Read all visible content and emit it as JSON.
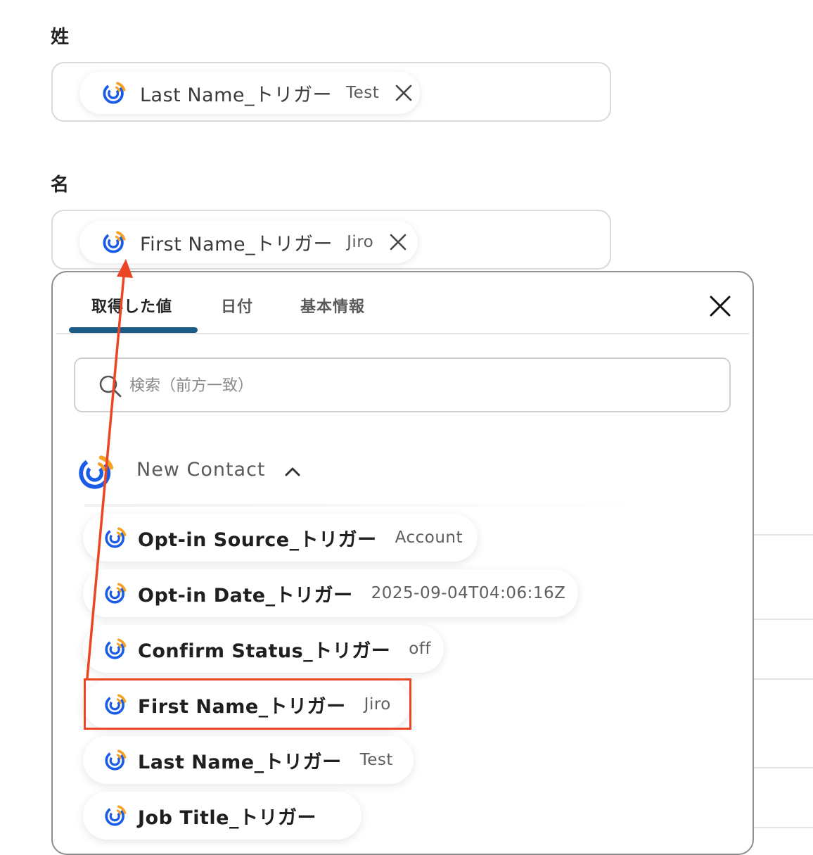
{
  "fields": {
    "last_name": {
      "label": "姓",
      "chip": {
        "name": "Last Name_トリガー",
        "value": "Test"
      }
    },
    "first_name": {
      "label": "名",
      "chip": {
        "name": "First Name_トリガー",
        "value": "Jiro"
      }
    }
  },
  "panel": {
    "tabs": [
      {
        "label": "取得した値",
        "active": true
      },
      {
        "label": "日付",
        "active": false
      },
      {
        "label": "基本情報",
        "active": false
      }
    ],
    "search": {
      "placeholder": "検索（前方一致）",
      "value": ""
    },
    "group": {
      "title": "New Contact",
      "expanded": true,
      "items": [
        {
          "name": "Opt-in Source_トリガー",
          "value": "Account"
        },
        {
          "name": "Opt-in Date_トリガー",
          "value": "2025-09-04T04:06:16Z"
        },
        {
          "name": "Confirm Status_トリガー",
          "value": "off"
        },
        {
          "name": "First Name_トリガー",
          "value": "Jiro",
          "highlighted": true
        },
        {
          "name": "Last Name_トリガー",
          "value": "Test"
        },
        {
          "name": "Job Title_トリガー",
          "value": ""
        }
      ]
    }
  },
  "annotation": {
    "color": "#ec4524"
  },
  "colors": {
    "accent": "#1a5c86",
    "logo_blue": "#1a5ce5",
    "logo_orange": "#f5a020"
  }
}
